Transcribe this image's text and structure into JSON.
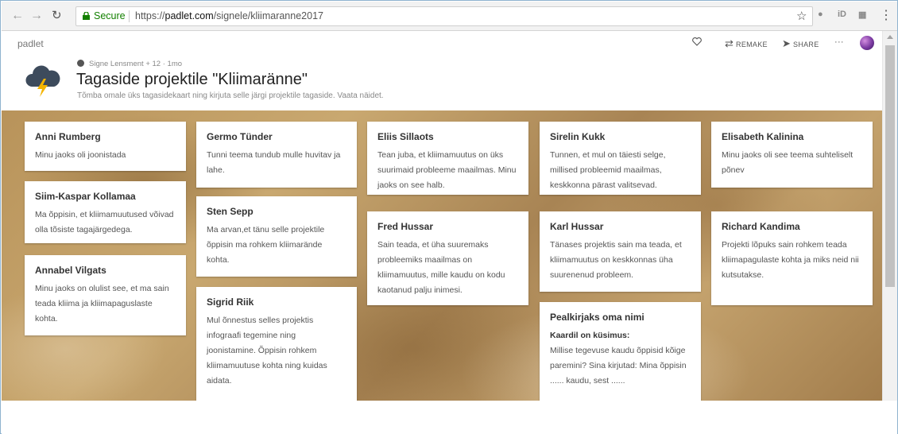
{
  "browser": {
    "secure_label": "Secure",
    "url_scheme": "https://",
    "url_host": "padlet.com",
    "url_path": "/signele/kliimaranne2017",
    "ext_iD": "iD"
  },
  "header": {
    "brand": "padlet",
    "remake_label": "REMAKE",
    "share_label": "SHARE",
    "more_label": "···"
  },
  "wall": {
    "author": "Signe Lensment",
    "contributors": "+ 12",
    "separator": "·",
    "age": "1mo",
    "title": "Tagaside projektile \"Kliimaränne\"",
    "description": "Tõmba omale üks tagasidekaart ning kirjuta selle järgi projektile tagaside. Vaata näidet."
  },
  "cards": [
    {
      "title": "Anni Rumberg",
      "body": "Minu jaoks oli joonistada"
    },
    {
      "title": "Siim-Kaspar Kollamaa",
      "body": "Ma õppisin, et kliimamuutused võivad olla tõsiste tagajärgedega."
    },
    {
      "title": "Annabel Vilgats",
      "body": "Minu jaoks on olulist see, et ma sain teada kliima ja kliimapaguslaste kohta."
    },
    {
      "title": "Germo Tünder",
      "body": "Tunni teema tundub mulle huvitav ja lahe."
    },
    {
      "title": "Sten Sepp",
      "body": "Ma arvan,et tänu selle projektile õppisin ma rohkem kliimarände kohta."
    },
    {
      "title": "Sigrid Riik",
      "body": "Mul õnnestus selles projektis infograafi tegemine ning joonistamine. Õppisin rohkem kliimamuutuse kohta ning kuidas aidata."
    },
    {
      "title": "Eliis Sillaots",
      "body": "Tean juba, et kliimamuutus on üks suurimaid probleeme maailmas. Minu jaoks on see halb."
    },
    {
      "title": "Fred Hussar",
      "body": "Sain teada, et üha suuremaks probleemiks maailmas on kliimamuutus, mille kaudu on kodu kaotanud palju inimesi."
    },
    {
      "title": "Sirelin Kukk",
      "body": "Tunnen, et mul on täiesti selge, millised probleemid maailmas, keskkonna pärast valitsevad."
    },
    {
      "title": "Karl Hussar",
      "body": "Tänases projektis sain ma teada, et kliimamuutus on keskkonnas üha suurenenud probleem."
    },
    {
      "title": "Pealkirjaks oma nimi",
      "body_bold": "Kaardil on küsimus:",
      "body": "Millise tegevuse kaudu õppisid kõige paremini? Sina kirjutad: Mina õppisin ...... kaudu, sest ......"
    },
    {
      "title": "Elisabeth Kalinina",
      "body": "Minu jaoks oli see teema suhteliselt põnev"
    },
    {
      "title": "Richard Kandima",
      "body": "Projekti lõpuks sain rohkem teada kliimapagulaste kohta ja miks neid nii kutsutakse."
    }
  ],
  "colors": {
    "secure_green": "#138000",
    "wall_brown": "#b8935a",
    "icon_blue": "#3d4b5c",
    "bolt_yellow": "#f4b400"
  }
}
